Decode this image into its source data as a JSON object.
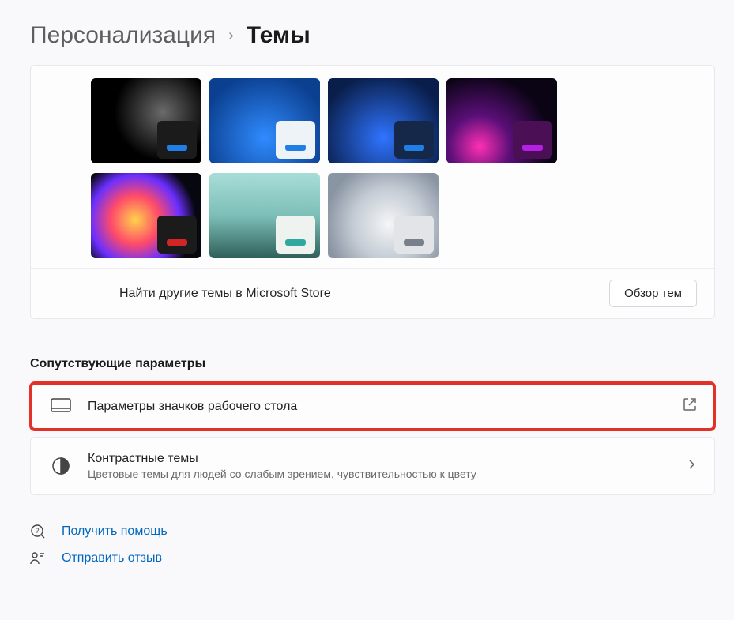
{
  "breadcrumb": {
    "parent": "Персонализация",
    "current": "Темы"
  },
  "themes": [
    {
      "bg": "radial-gradient(circle at 65% 40%, #6a6a6a 0%, #000 55%)",
      "chip_bg": "#1b1b1b",
      "chip_bar": "#1f7fe6"
    },
    {
      "bg": "radial-gradient(circle at 50% 70%, #2f8bff 0%, #0b3f8f 80%)",
      "chip_bg": "#eef3f8",
      "chip_bar": "#1f7fe6"
    },
    {
      "bg": "radial-gradient(circle at 50% 70%, #2f74ff 0%, #091e4a 80%)",
      "chip_bg": "#16284a",
      "chip_bar": "#1f7fe6"
    },
    {
      "bg": "radial-gradient(circle at 30% 80%, #ff2fb3 0%, #5a0f78 30%, #0a0414 70%)",
      "chip_bg": "#4a0f55",
      "chip_bar": "#b51fe6"
    },
    {
      "bg": "radial-gradient(circle at 40% 55%, #ffd24a 0%, #ff4a6a 30%, #6a2fff 55%, #070710 75%)",
      "chip_bg": "#1b1b1b",
      "chip_bar": "#d22626"
    },
    {
      "bg": "linear-gradient(180deg, #a8ddd7 0%, #7cbfb8 50%, #2f5f59 100%)",
      "chip_bg": "#eef3f0",
      "chip_bar": "#2fa8a0"
    },
    {
      "bg": "radial-gradient(circle at 55% 60%, #f4f6f8 0%, #c4cbd4 45%, #8a95a3 80%)",
      "chip_bg": "#e2e4e7",
      "chip_bar": "#7a8089"
    }
  ],
  "store": {
    "text": "Найти другие темы в Microsoft Store",
    "button": "Обзор тем"
  },
  "related_heading": "Сопутствующие параметры",
  "rows": {
    "desktop_icons": {
      "title": "Параметры значков рабочего стола"
    },
    "contrast": {
      "title": "Контрастные темы",
      "sub": "Цветовые темы для людей со слабым зрением, чувствительностью к цвету"
    }
  },
  "footer": {
    "help": "Получить помощь",
    "feedback": "Отправить отзыв"
  }
}
